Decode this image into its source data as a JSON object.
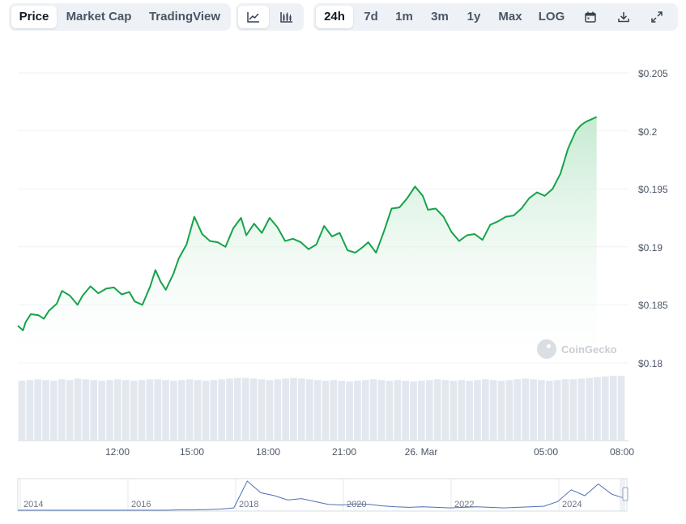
{
  "toolbar": {
    "data_tabs": [
      {
        "label": "Price",
        "active": true
      },
      {
        "label": "Market Cap",
        "active": false
      },
      {
        "label": "TradingView",
        "active": false
      }
    ],
    "chart_types": [
      {
        "icon": "line-chart-icon",
        "active": true
      },
      {
        "icon": "candlestick-chart-icon",
        "active": false
      }
    ],
    "ranges": [
      {
        "label": "24h",
        "active": true
      },
      {
        "label": "7d",
        "active": false
      },
      {
        "label": "1m",
        "active": false
      },
      {
        "label": "3m",
        "active": false
      },
      {
        "label": "1y",
        "active": false
      },
      {
        "label": "Max",
        "active": false
      },
      {
        "label": "LOG",
        "active": false
      }
    ],
    "tools": [
      {
        "icon": "calendar-icon"
      },
      {
        "icon": "download-icon"
      },
      {
        "icon": "fullscreen-icon"
      }
    ]
  },
  "watermark": "CoinGecko",
  "colors": {
    "line": "#16a34a",
    "area_top": "#bfe8cc",
    "volume": "#e3e8ef",
    "grid": "#eef2f6",
    "navigator_line": "#4e6fb1"
  },
  "chart_data": {
    "type": "line",
    "title": "",
    "xlabel": "",
    "ylabel": "",
    "ylim": [
      0.18,
      0.205
    ],
    "y_ticks": [
      "$0.205",
      "$0.2",
      "$0.195",
      "$0.19",
      "$0.185",
      "$0.18"
    ],
    "y_tick_values": [
      0.205,
      0.2,
      0.195,
      0.19,
      0.185,
      0.18
    ],
    "x_range_hours": [
      9.8,
      33.2
    ],
    "x_ticks": [
      {
        "label": "12:00",
        "hour": 12
      },
      {
        "label": "15:00",
        "hour": 15
      },
      {
        "label": "18:00",
        "hour": 18
      },
      {
        "label": "21:00",
        "hour": 21
      },
      {
        "label": "26. Mar",
        "hour": 24
      },
      {
        "label": "05:00",
        "hour": 29
      },
      {
        "label": "08:00",
        "hour": 32
      }
    ],
    "series": [
      {
        "x": [
          9.8,
          10.0,
          10.1,
          10.3,
          10.6,
          10.8,
          11.0,
          11.3,
          11.5,
          11.8,
          12.1,
          12.3,
          12.6,
          12.9,
          13.2,
          13.5,
          13.8,
          14.1,
          14.3,
          14.6,
          14.9,
          15.1,
          15.3,
          15.5,
          15.8,
          16.0,
          16.3,
          16.6,
          16.9,
          17.2,
          17.5,
          17.8,
          18.1,
          18.4,
          18.6,
          18.9,
          19.2,
          19.5,
          19.8,
          20.1,
          20.4,
          20.7,
          21.0,
          21.3,
          21.6,
          21.9,
          22.2,
          22.5,
          22.8,
          23.1,
          23.3,
          23.6,
          23.9,
          24.2,
          24.5,
          24.8,
          25.1,
          25.4,
          25.6,
          25.9,
          26.2,
          26.5,
          26.8,
          27.1,
          27.4,
          27.7,
          28.0,
          28.3,
          28.6,
          28.9,
          29.2,
          29.5,
          29.8,
          30.1,
          30.4,
          30.7,
          31.0,
          31.3,
          31.5,
          31.7,
          31.9,
          32.1
        ],
        "y": [
          0.1832,
          0.1828,
          0.1835,
          0.1842,
          0.1841,
          0.1838,
          0.1845,
          0.1851,
          0.1862,
          0.1858,
          0.185,
          0.1858,
          0.1866,
          0.186,
          0.1864,
          0.1865,
          0.1859,
          0.1861,
          0.1853,
          0.185,
          0.1866,
          0.188,
          0.187,
          0.1863,
          0.1877,
          0.189,
          0.1902,
          0.1926,
          0.1911,
          0.1905,
          0.1904,
          0.19,
          0.1916,
          0.1925,
          0.191,
          0.192,
          0.1912,
          0.1925,
          0.1917,
          0.1905,
          0.1907,
          0.1904,
          0.1898,
          0.1902,
          0.1918,
          0.1909,
          0.1912,
          0.1897,
          0.1895,
          0.19,
          0.1904,
          0.1895,
          0.1913,
          0.1933,
          0.1934,
          0.1942,
          0.1952,
          0.1944,
          0.1932,
          0.1933,
          0.1926,
          0.1913,
          0.1905,
          0.191,
          0.1911,
          0.1906,
          0.1919,
          0.1922,
          0.1926,
          0.1927,
          0.1933,
          0.1942,
          0.1947,
          0.1944,
          0.195,
          0.1963,
          0.1985,
          0.2,
          0.2005,
          0.2008,
          0.201,
          0.2012
        ]
      }
    ]
  },
  "volume": {
    "values": [
      0.84,
      0.85,
      0.86,
      0.85,
      0.84,
      0.86,
      0.85,
      0.87,
      0.86,
      0.85,
      0.84,
      0.85,
      0.86,
      0.85,
      0.84,
      0.85,
      0.86,
      0.86,
      0.85,
      0.84,
      0.85,
      0.86,
      0.85,
      0.84,
      0.85,
      0.86,
      0.87,
      0.88,
      0.88,
      0.87,
      0.86,
      0.85,
      0.86,
      0.87,
      0.88,
      0.87,
      0.86,
      0.85,
      0.84,
      0.85,
      0.84,
      0.83,
      0.84,
      0.85,
      0.86,
      0.85,
      0.84,
      0.85,
      0.84,
      0.83,
      0.84,
      0.85,
      0.86,
      0.85,
      0.84,
      0.85,
      0.84,
      0.85,
      0.86,
      0.85,
      0.84,
      0.85,
      0.86,
      0.87,
      0.86,
      0.85,
      0.84,
      0.85,
      0.86,
      0.86,
      0.87,
      0.88,
      0.89,
      0.9,
      0.91,
      0.91
    ]
  },
  "navigator": {
    "labels": [
      "2014",
      "2016",
      "2018",
      "2020",
      "2022",
      "2024"
    ],
    "series": [
      0.0,
      0.0,
      0.0,
      0.0,
      0.0,
      0.0,
      0.0,
      0.0,
      0.0,
      0.0,
      0.0,
      0.0,
      0.01,
      0.01,
      0.02,
      0.04,
      0.08,
      1.0,
      0.6,
      0.5,
      0.35,
      0.4,
      0.3,
      0.2,
      0.18,
      0.22,
      0.2,
      0.15,
      0.12,
      0.1,
      0.12,
      0.1,
      0.08,
      0.1,
      0.12,
      0.1,
      0.08,
      0.1,
      0.12,
      0.14,
      0.3,
      0.7,
      0.5,
      0.9,
      0.55,
      0.4
    ]
  }
}
